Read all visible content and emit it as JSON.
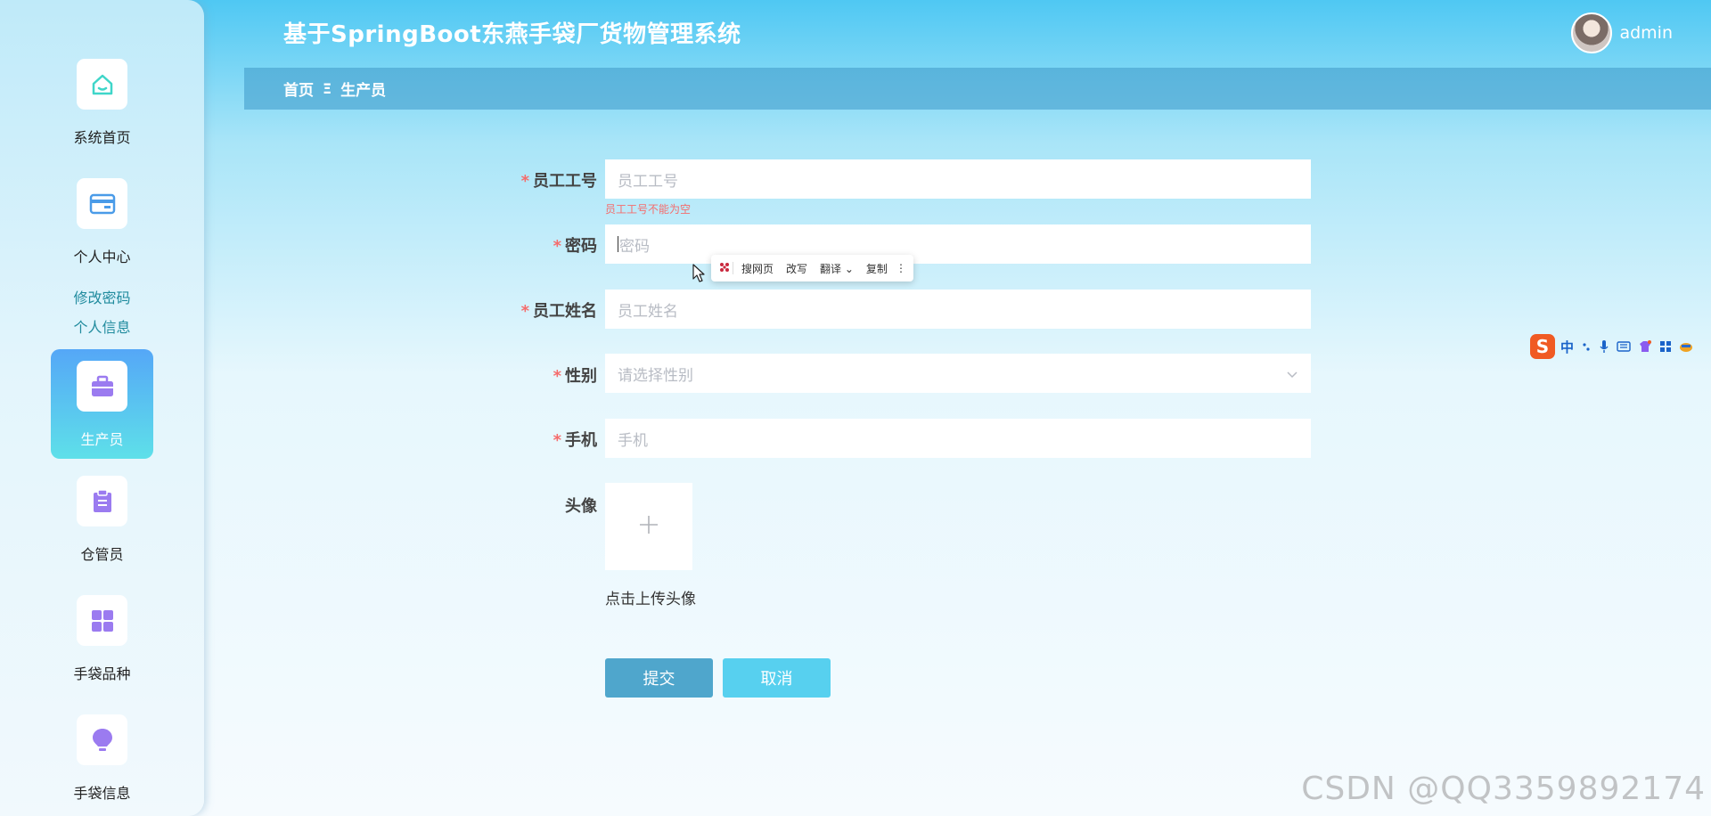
{
  "app": {
    "title": "基于SpringBoot东燕手袋厂货物管理系统"
  },
  "user": {
    "name": "admin"
  },
  "breadcrumb": {
    "home": "首页",
    "separator": "Ξ",
    "current": "生产员"
  },
  "sidebar": {
    "items": [
      {
        "label": "系统首页",
        "icon": "home-icon"
      },
      {
        "label": "个人中心",
        "icon": "card-icon"
      },
      {
        "label": "生产员",
        "icon": "briefcase-icon",
        "active": true
      },
      {
        "label": "仓管员",
        "icon": "clipboard-icon"
      },
      {
        "label": "手袋品种",
        "icon": "grid-icon"
      },
      {
        "label": "手袋信息",
        "icon": "bulb-icon"
      }
    ],
    "sub_items": [
      {
        "label": "修改密码"
      },
      {
        "label": "个人信息"
      }
    ]
  },
  "form": {
    "employee_no": {
      "label": "员工工号",
      "placeholder": "员工工号",
      "error": "员工工号不能为空"
    },
    "password": {
      "label": "密码",
      "placeholder": "密码"
    },
    "employee_name": {
      "label": "员工姓名",
      "placeholder": "员工姓名"
    },
    "gender": {
      "label": "性别",
      "placeholder": "请选择性别"
    },
    "phone": {
      "label": "手机",
      "placeholder": "手机"
    },
    "avatar": {
      "label": "头像",
      "hint": "点击上传头像"
    },
    "submit_label": "提交",
    "cancel_label": "取消"
  },
  "selection_toolbar": {
    "items": [
      "搜网页",
      "改写",
      "翻译",
      "复制"
    ]
  },
  "ime": {
    "logo": "S",
    "mode": "中"
  },
  "watermark": "CSDN @QQ3359892174",
  "colors": {
    "accent": "#4fa6cc",
    "cancel": "#57d0ef",
    "error": "#f56c6c",
    "active_nav_top": "#55a7f7",
    "active_nav_bottom": "#5ee0e9"
  }
}
